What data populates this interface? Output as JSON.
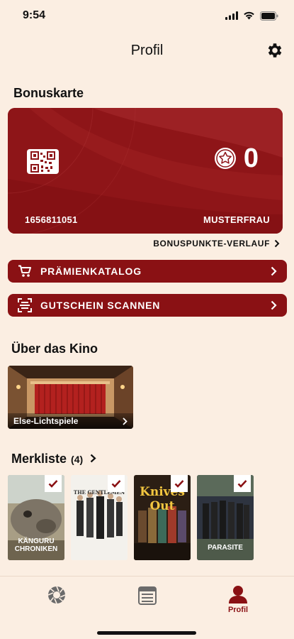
{
  "status": {
    "time": "9:54"
  },
  "header": {
    "title": "Profil"
  },
  "bonus": {
    "section_title": "Bonuskarte",
    "points": "0",
    "card_number": "1656811051",
    "card_name": "MUSTERFRAU",
    "history_label": "BONUSPUNKTE-VERLAUF"
  },
  "actions": {
    "catalog_label": "PRÄMIENKATALOG",
    "scan_label": "GUTSCHEIN SCANNEN"
  },
  "cinema": {
    "section_title": "Über das Kino",
    "tile_label": "Else-Lichtspiele"
  },
  "watchlist": {
    "title": "Merkliste",
    "count": "(4)",
    "posters": [
      {
        "title": "KÄNGURU\nCHRONIKEN",
        "display": "KÄNGURU CHRONIKEN"
      },
      {
        "title": "THE GENTLEMEN",
        "display": "THE GENTLEMEN"
      },
      {
        "title": "Knives Out",
        "display": "Knives Out"
      },
      {
        "title": "PARASITE",
        "display": "PARASITE"
      }
    ]
  },
  "tabbar": {
    "profile_label": "Profil"
  },
  "colors": {
    "accent": "#8a1114",
    "background": "#fbeee2"
  }
}
